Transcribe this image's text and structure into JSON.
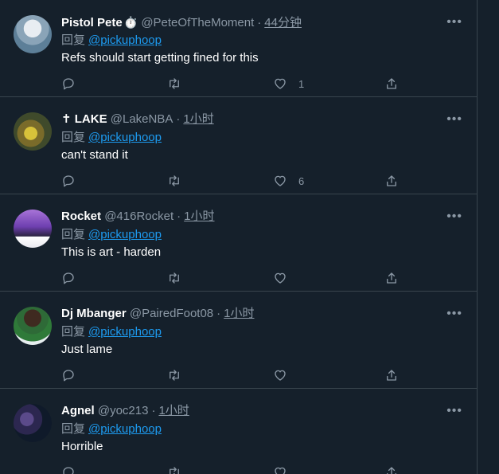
{
  "reply_prefix": "回复",
  "tweets": [
    {
      "name": "Pistol Pete",
      "name_badge": "⏱️",
      "handle": "@PeteOfTheMoment",
      "sep": "·",
      "time": "44分钟",
      "reply_to": "@pickuphoop",
      "text": "Refs should start getting fined for this",
      "likes": "1"
    },
    {
      "name": "✝ LAKE",
      "handle": "@LakeNBA",
      "sep": "·",
      "time": "1小时",
      "reply_to": "@pickuphoop",
      "text": "can't stand it",
      "likes": "6"
    },
    {
      "name": "Rocket",
      "handle": "@416Rocket",
      "sep": "·",
      "time": "1小时",
      "reply_to": "@pickuphoop",
      "text": "This is art - harden",
      "likes": ""
    },
    {
      "name": "Dj Mbanger",
      "handle": "@PairedFoot08",
      "sep": "·",
      "time": "1小时",
      "reply_to": "@pickuphoop",
      "text": "Just lame",
      "likes": ""
    },
    {
      "name": "Agnel",
      "handle": "@yoc213",
      "sep": "·",
      "time": "1小时",
      "reply_to": "@pickuphoop",
      "text": "Horrible",
      "likes": ""
    }
  ],
  "icons": {
    "more": "more-icon",
    "reply": "reply-icon",
    "retweet": "retweet-icon",
    "like": "heart-icon",
    "share": "share-icon"
  },
  "colors": {
    "background": "#15202b",
    "link": "#1d9bf0",
    "muted": "#8b98a5",
    "border": "#38444d"
  }
}
